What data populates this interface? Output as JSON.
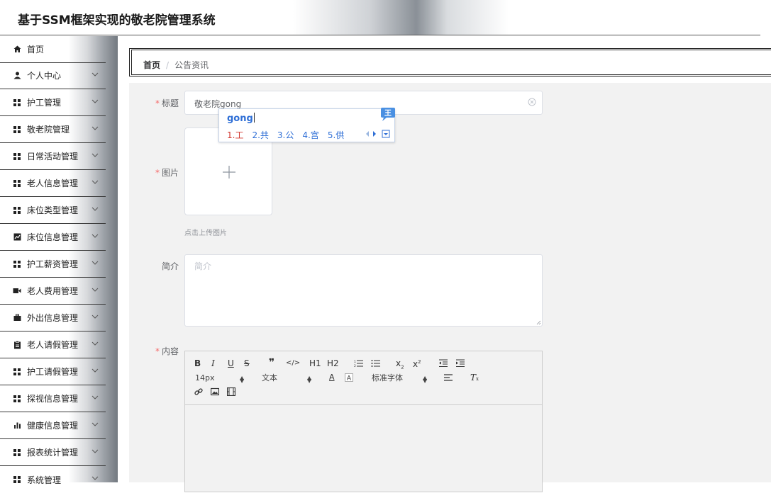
{
  "header": {
    "title": "基于SSM框架实现的敬老院管理系统"
  },
  "sidebar": {
    "items": [
      {
        "label": "首页",
        "icon": "home-icon",
        "has_arrow": false
      },
      {
        "label": "个人中心",
        "icon": "user-icon",
        "has_arrow": true
      },
      {
        "label": "护工管理",
        "icon": "grid-icon",
        "has_arrow": true
      },
      {
        "label": "敬老院管理",
        "icon": "grid-icon",
        "has_arrow": true
      },
      {
        "label": "日常活动管理",
        "icon": "grid-icon",
        "has_arrow": true
      },
      {
        "label": "老人信息管理",
        "icon": "grid-icon",
        "has_arrow": true
      },
      {
        "label": "床位类型管理",
        "icon": "grid-icon",
        "has_arrow": true
      },
      {
        "label": "床位信息管理",
        "icon": "chart-icon",
        "has_arrow": true
      },
      {
        "label": "护工薪资管理",
        "icon": "grid-icon",
        "has_arrow": true
      },
      {
        "label": "老人费用管理",
        "icon": "video-icon",
        "has_arrow": true
      },
      {
        "label": "外出信息管理",
        "icon": "briefcase-icon",
        "has_arrow": true
      },
      {
        "label": "老人请假管理",
        "icon": "clipboard-icon",
        "has_arrow": true
      },
      {
        "label": "护工请假管理",
        "icon": "grid-icon",
        "has_arrow": true
      },
      {
        "label": "探视信息管理",
        "icon": "grid-icon",
        "has_arrow": true
      },
      {
        "label": "健康信息管理",
        "icon": "bar-chart-icon",
        "has_arrow": true
      },
      {
        "label": "报表统计管理",
        "icon": "grid-icon",
        "has_arrow": true
      },
      {
        "label": "系统管理",
        "icon": "grid-icon",
        "has_arrow": true
      }
    ]
  },
  "breadcrumb": {
    "home": "首页",
    "separator": "/",
    "current": "公告资讯"
  },
  "form": {
    "title_label": "标题",
    "title_value": "敬老院gong",
    "image_label": "图片",
    "upload_tip": "点击上传图片",
    "intro_label": "简介",
    "intro_placeholder": "简介",
    "content_label": "内容"
  },
  "ime": {
    "composition": "gong",
    "candidates": [
      "1.工",
      "2.共",
      "3.公",
      "4.宫",
      "5.供"
    ],
    "logo_char": "王"
  },
  "editor": {
    "font_size": "14px",
    "block_format": "文本",
    "font_family": "标准字体",
    "h1": "H1",
    "h2": "H2"
  },
  "colors": {
    "required": "#f56c6c",
    "ime_blue": "#2f6fd6",
    "ime_first": "#d0342c"
  }
}
